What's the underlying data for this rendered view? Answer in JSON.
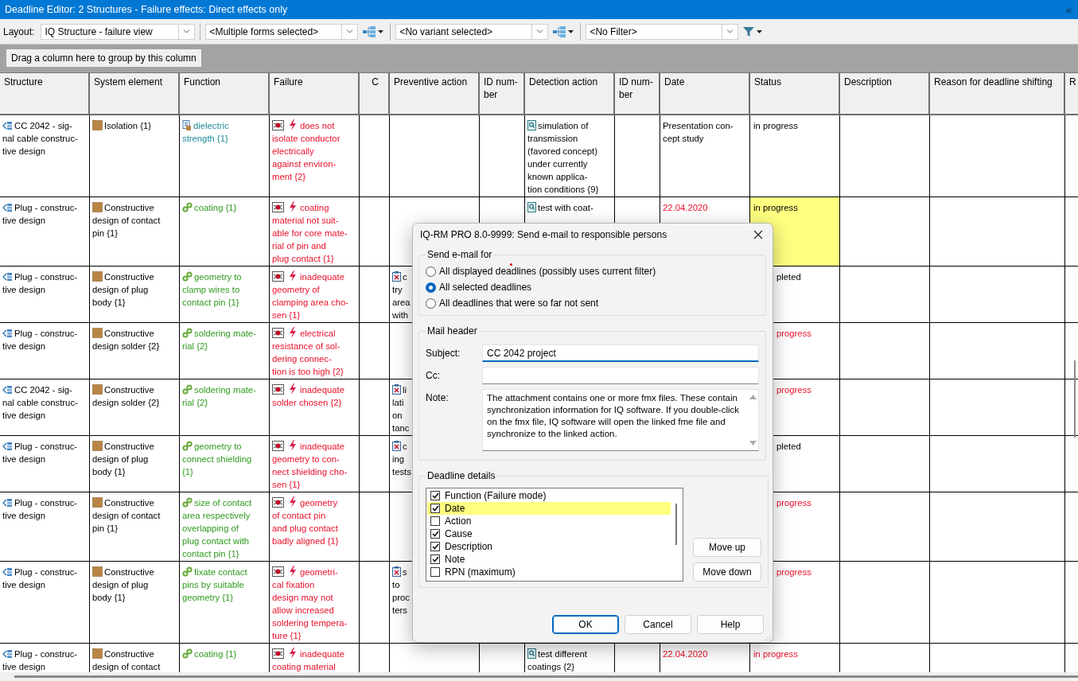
{
  "window": {
    "title": "Deadline Editor: 2 Structures - Failure effects: Direct effects only",
    "collapse_glyph": "«"
  },
  "toolbar": {
    "layout_label": "Layout:",
    "combos": [
      {
        "value": "IQ Structure - failure view",
        "kind": "plain"
      },
      {
        "value": "<Multiple forms selected>",
        "kind": "tree"
      },
      {
        "value": "<No variant selected>",
        "kind": "tree"
      },
      {
        "value": "<No Filter>",
        "kind": "filter"
      }
    ]
  },
  "group_panel": {
    "hint": "Drag a column here to group by this column"
  },
  "table": {
    "columns": [
      "Structure",
      "System element",
      "Function",
      "Failure",
      "C",
      "Preventive action",
      "ID num-\nber",
      "Detection action",
      "ID num-\nber",
      "Date",
      "Status",
      "Description",
      "Reason for deadline shifting",
      "R"
    ],
    "rows": [
      {
        "structure": "CC 2042 - sig-\nnal cable construc-\ntive design",
        "system_element": "Isolation {1}",
        "function": {
          "text": "dielectric\nstrength {1}",
          "kind": "document"
        },
        "failure": "does not\nisolate conductor\nelectrically\nagainst environ-\nment {2}",
        "detection": "simulation of\ntransmission\n(favored concept)\nunder currently\nknown applica-\ntion conditions {9}",
        "date": {
          "text": "Presentation con-\ncept study",
          "overdue": false
        },
        "status": {
          "text": "in progress",
          "overdue": false,
          "highlighted": false,
          "covered": false
        }
      },
      {
        "structure": "Plug - construc-\ntive design",
        "system_element": "Constructive\ndesign of contact\npin {1}",
        "function": {
          "text": "coating {1}",
          "kind": "link"
        },
        "failure": "coating\nmaterial not suit-\nable for core mate-\nrial of pin and\nplug contact {1}",
        "detection": "test with coat-",
        "date": {
          "text": "22.04.2020",
          "overdue": true
        },
        "status": {
          "text": "in progress",
          "overdue": false,
          "highlighted": true,
          "covered": false
        }
      },
      {
        "structure": "Plug - construc-\ntive design",
        "system_element": "Constructive\ndesign of plug\nbody {1}",
        "function": {
          "text": "geometry to\nclamp wires to\ncontact pin {1}",
          "kind": "link"
        },
        "failure": "inadequate\ngeometry of\nclamping area cho-\nsen {1}",
        "preventive": "c\ntry\narea\nwith",
        "status": {
          "text": "pleted",
          "overdue": false,
          "highlighted": false,
          "covered": true
        }
      },
      {
        "structure": "Plug - construc-\ntive design",
        "system_element": "Constructive\ndesign solder {2}",
        "function": {
          "text": "soldering mate-\nrial {2}",
          "kind": "link"
        },
        "failure": "electrical\nresistance of sol-\ndering connec-\ntion is too high {2}",
        "status": {
          "text": "progress",
          "overdue": true,
          "highlighted": false,
          "covered": true
        }
      },
      {
        "structure": "CC 2042 - sig-\nnal cable construc-\ntive design",
        "system_element": "Constructive\ndesign solder {2}",
        "function": {
          "text": "soldering mate-\nrial {2}",
          "kind": "link"
        },
        "failure": "inadequate\nsolder chosen {2}",
        "preventive": "li\nlati\non\ntanc",
        "status": {
          "text": "progress",
          "overdue": true,
          "highlighted": false,
          "covered": true
        }
      },
      {
        "structure": "Plug - construc-\ntive design",
        "system_element": "Constructive\ndesign of plug\nbody {1}",
        "function": {
          "text": "geometry to\nconnect shielding\n{1}",
          "kind": "link"
        },
        "failure": "inadequate\ngeometry to con-\nnect shielding cho-\nsen {1}",
        "preventive": "c\ning\ntests",
        "status": {
          "text": "pleted",
          "overdue": false,
          "highlighted": false,
          "covered": true
        }
      },
      {
        "structure": "Plug - construc-\ntive design",
        "system_element": "Constructive\ndesign of contact\npin {1}",
        "function": {
          "text": "size of contact\narea respectively\noverlapping of\nplug contact with\ncontact pin {1}",
          "kind": "link"
        },
        "failure": "geometry\nof contact pin\nand plug contact\nbadly aligned {1}",
        "status": {
          "text": "progress",
          "overdue": true,
          "highlighted": false,
          "covered": true
        }
      },
      {
        "structure": "Plug - construc-\ntive design",
        "system_element": "Constructive\ndesign of plug\nbody {1}",
        "function": {
          "text": "fixate contact\npins by suitable\ngeometry {1}",
          "kind": "link"
        },
        "failure": "geometri-\ncal fixation\ndesign may not\nallow increased\nsoldering tempera-\nture {1}",
        "preventive": "s\nto\nproc\nters",
        "status": {
          "text": "progress",
          "overdue": true,
          "highlighted": false,
          "covered": true
        }
      },
      {
        "structure": "Plug - construc-\ntive design",
        "system_element": "Constructive\ndesign of contact",
        "function": {
          "text": "coating {1}",
          "kind": "link"
        },
        "failure": "inadequate\ncoating material",
        "detection": "test different\ncoatings {2}",
        "date": {
          "text": "22.04.2020",
          "overdue": true
        },
        "status": {
          "text": "in progress",
          "overdue": true,
          "highlighted": false,
          "covered": false
        }
      }
    ]
  },
  "dialog": {
    "title": "IQ-RM PRO 8.0-9999: Send e-mail to responsible persons",
    "send_for": {
      "legend": "Send e-mail for",
      "options": [
        {
          "label": "All displayed deadlines (possibly uses current filter)",
          "selected": false
        },
        {
          "label": "All selected deadlines",
          "selected": true
        },
        {
          "label": "All deadlines that were so far not sent",
          "selected": false
        }
      ]
    },
    "mail_header": {
      "legend": "Mail header",
      "subject_label": "Subject:",
      "subject": "CC 2042 project",
      "subject_focused": true,
      "cc_label": "Cc:",
      "note_label": "Note:",
      "note": "The attachment contains one or more fmx files. These contain synchronization information for IQ software. If you double-click on the fmx file, IQ software will open the linked fme file and synchronize to the linked action."
    },
    "details": {
      "legend": "Deadline details",
      "items": [
        {
          "label": "Function (Failure mode)",
          "checked": true,
          "selected": false
        },
        {
          "label": "Date",
          "checked": true,
          "selected": true
        },
        {
          "label": "Action",
          "checked": false,
          "selected": false
        },
        {
          "label": "Cause",
          "checked": true,
          "selected": false
        },
        {
          "label": "Description",
          "checked": true,
          "selected": false
        },
        {
          "label": "Note",
          "checked": true,
          "selected": false
        },
        {
          "label": "RPN (maximum)",
          "checked": false,
          "selected": false
        }
      ],
      "move_up": "Move up",
      "move_down": "Move down"
    },
    "buttons": [
      {
        "label": "OK",
        "default": true
      },
      {
        "label": "Cancel",
        "default": false
      },
      {
        "label": "Help",
        "default": false
      }
    ]
  }
}
